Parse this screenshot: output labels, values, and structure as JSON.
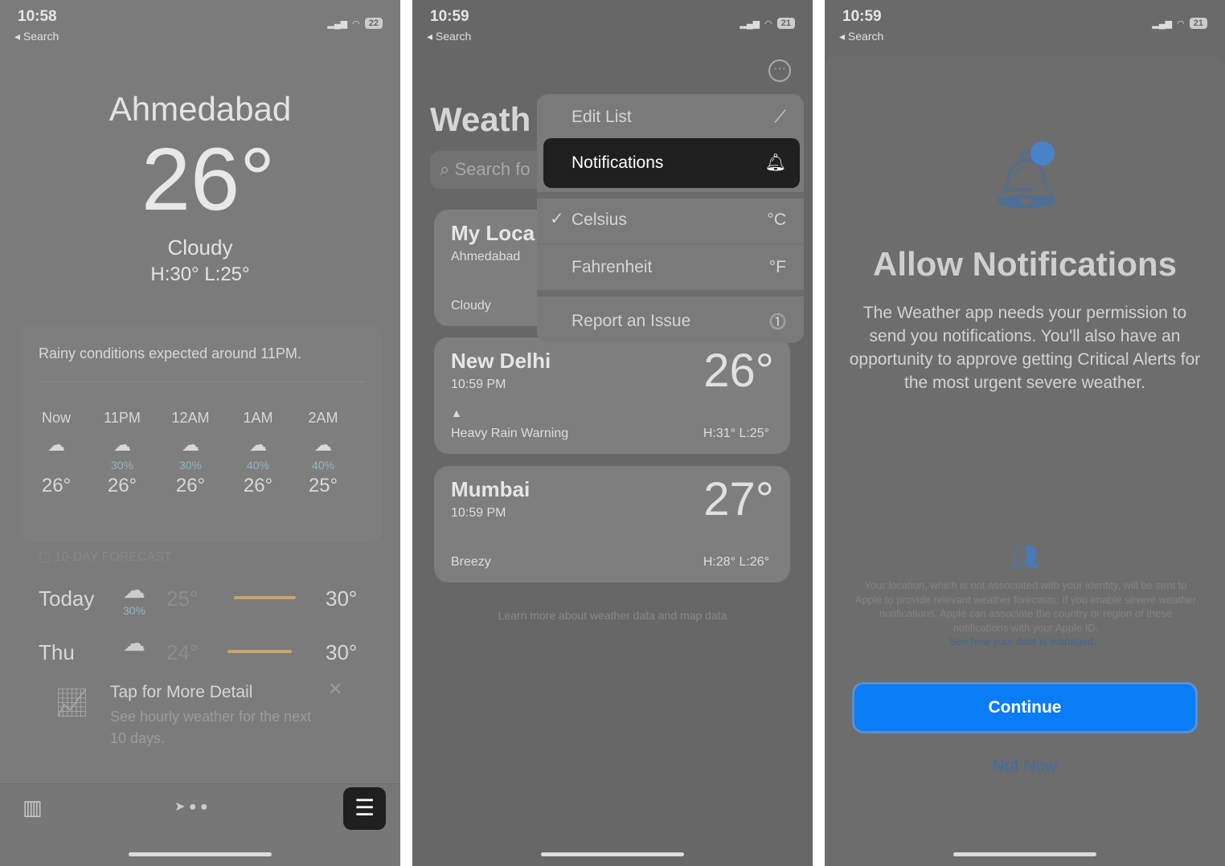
{
  "screens": [
    {
      "time": "10:58",
      "back": "Search",
      "battery": "22",
      "city": "Ahmedabad",
      "temp": "26°",
      "condition": "Cloudy",
      "hilo": "H:30°  L:25°",
      "alert": "Rainy conditions expected around 11PM.",
      "hourly": [
        {
          "t": "Now",
          "pct": "",
          "icon": "cloud",
          "temp": "26°"
        },
        {
          "t": "11PM",
          "pct": "30%",
          "icon": "cloud-moon-rain",
          "temp": "26°"
        },
        {
          "t": "12AM",
          "pct": "30%",
          "icon": "cloud-rain",
          "temp": "26°"
        },
        {
          "t": "1AM",
          "pct": "40%",
          "icon": "cloud-rain",
          "temp": "26°"
        },
        {
          "t": "2AM",
          "pct": "40%",
          "icon": "cloud-rain",
          "temp": "25°"
        }
      ],
      "forecast_header": "10-DAY FORECAST",
      "days": [
        {
          "day": "Today",
          "pct": "30%",
          "low": "25°",
          "high": "30°"
        },
        {
          "day": "Thu",
          "pct": "",
          "low": "24°",
          "high": "30°"
        }
      ],
      "tip": {
        "title": "Tap for More Detail",
        "body": "See hourly weather for the next 10 days."
      }
    },
    {
      "time": "10:59",
      "back": "Search",
      "battery": "21",
      "title": "Weath",
      "search_placeholder": "Search fo",
      "menu": [
        {
          "label": "Edit List",
          "icon": "pencil"
        },
        {
          "label": "Notifications",
          "icon": "bell"
        },
        {
          "label": "Celsius",
          "icon": "°C",
          "checked": true
        },
        {
          "label": "Fahrenheit",
          "icon": "°F"
        },
        {
          "label": "Report an Issue",
          "icon": "exclamation-bubble"
        }
      ],
      "cards": [
        {
          "name": "My Loca",
          "sub": "Ahmedabad",
          "cond": "Cloudy"
        },
        {
          "name": "New Delhi",
          "sub": "10:59 PM",
          "temp": "26°",
          "cond": "Heavy Rain Warning",
          "hilo": "H:31°  L:25°"
        },
        {
          "name": "Mumbai",
          "sub": "10:59 PM",
          "temp": "27°",
          "cond": "Breezy",
          "hilo": "H:28°  L:26°"
        }
      ],
      "footer": {
        "pre": "Learn more about ",
        "link1": "weather data",
        "mid": " and ",
        "link2": "map data"
      }
    },
    {
      "time": "10:59",
      "back": "Search",
      "battery": "21",
      "title": "Allow Notifications",
      "body": "The Weather app needs your permission to send you notifications. You'll also have an opportunity to approve getting Critical Alerts for the most urgent severe weather.",
      "privacy": "Your location, which is not associated with your identity, will be sent to Apple to provide relevant weather forecasts. If you enable severe weather notifications, Apple can associate the country or region of these notifications with your Apple ID.",
      "privacy_link": "See how your data is managed...",
      "continue": "Continue",
      "not_now": "Not Now",
      "accent": "#0a7cf5"
    }
  ]
}
